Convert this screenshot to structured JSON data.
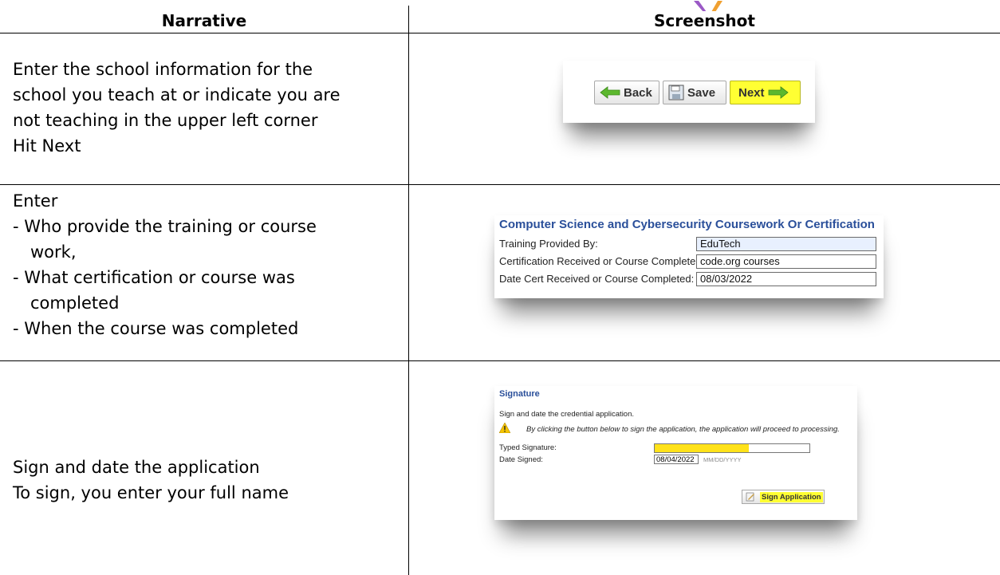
{
  "header": {
    "narrative": "Narrative",
    "screenshot": "Screenshot"
  },
  "rows": [
    {
      "narrative_lines": [
        "Enter the school information for the",
        "school you teach at or indicate you are",
        "not teaching in the upper left corner",
        "Hit Next"
      ]
    },
    {
      "narrative_lines": [
        "Enter",
        "- Who provide the training or course",
        "work,",
        "- What certification or course was",
        "completed",
        "- When the course was completed"
      ]
    },
    {
      "narrative_lines": [
        "Sign and date the application",
        "To sign, you enter your full name"
      ]
    }
  ],
  "nav_buttons": {
    "back": "Back",
    "save": "Save",
    "next": "Next"
  },
  "coursework": {
    "title": "Computer Science and Cybersecurity Coursework Or Certification",
    "labels": [
      "Training Provided By:",
      "Certification Received or Course Completed:",
      "Date Cert Received or Course Completed:"
    ],
    "values": [
      "EduTech",
      "code.org courses",
      "08/03/2022"
    ]
  },
  "signature": {
    "title": "Signature",
    "instruction": "Sign and date the credential application.",
    "notice": "By clicking the button below to sign the application, the application will proceed to processing.",
    "typed_label": "Typed Signature:",
    "date_label": "Date Signed:",
    "date_value": "08/04/2022",
    "date_hint": "MM/DD/YYYY",
    "button": "Sign Application"
  },
  "colors": {
    "highlight": "#ffff33",
    "title_blue": "#2a4f9a",
    "arrow_green": "#5cb82e"
  }
}
